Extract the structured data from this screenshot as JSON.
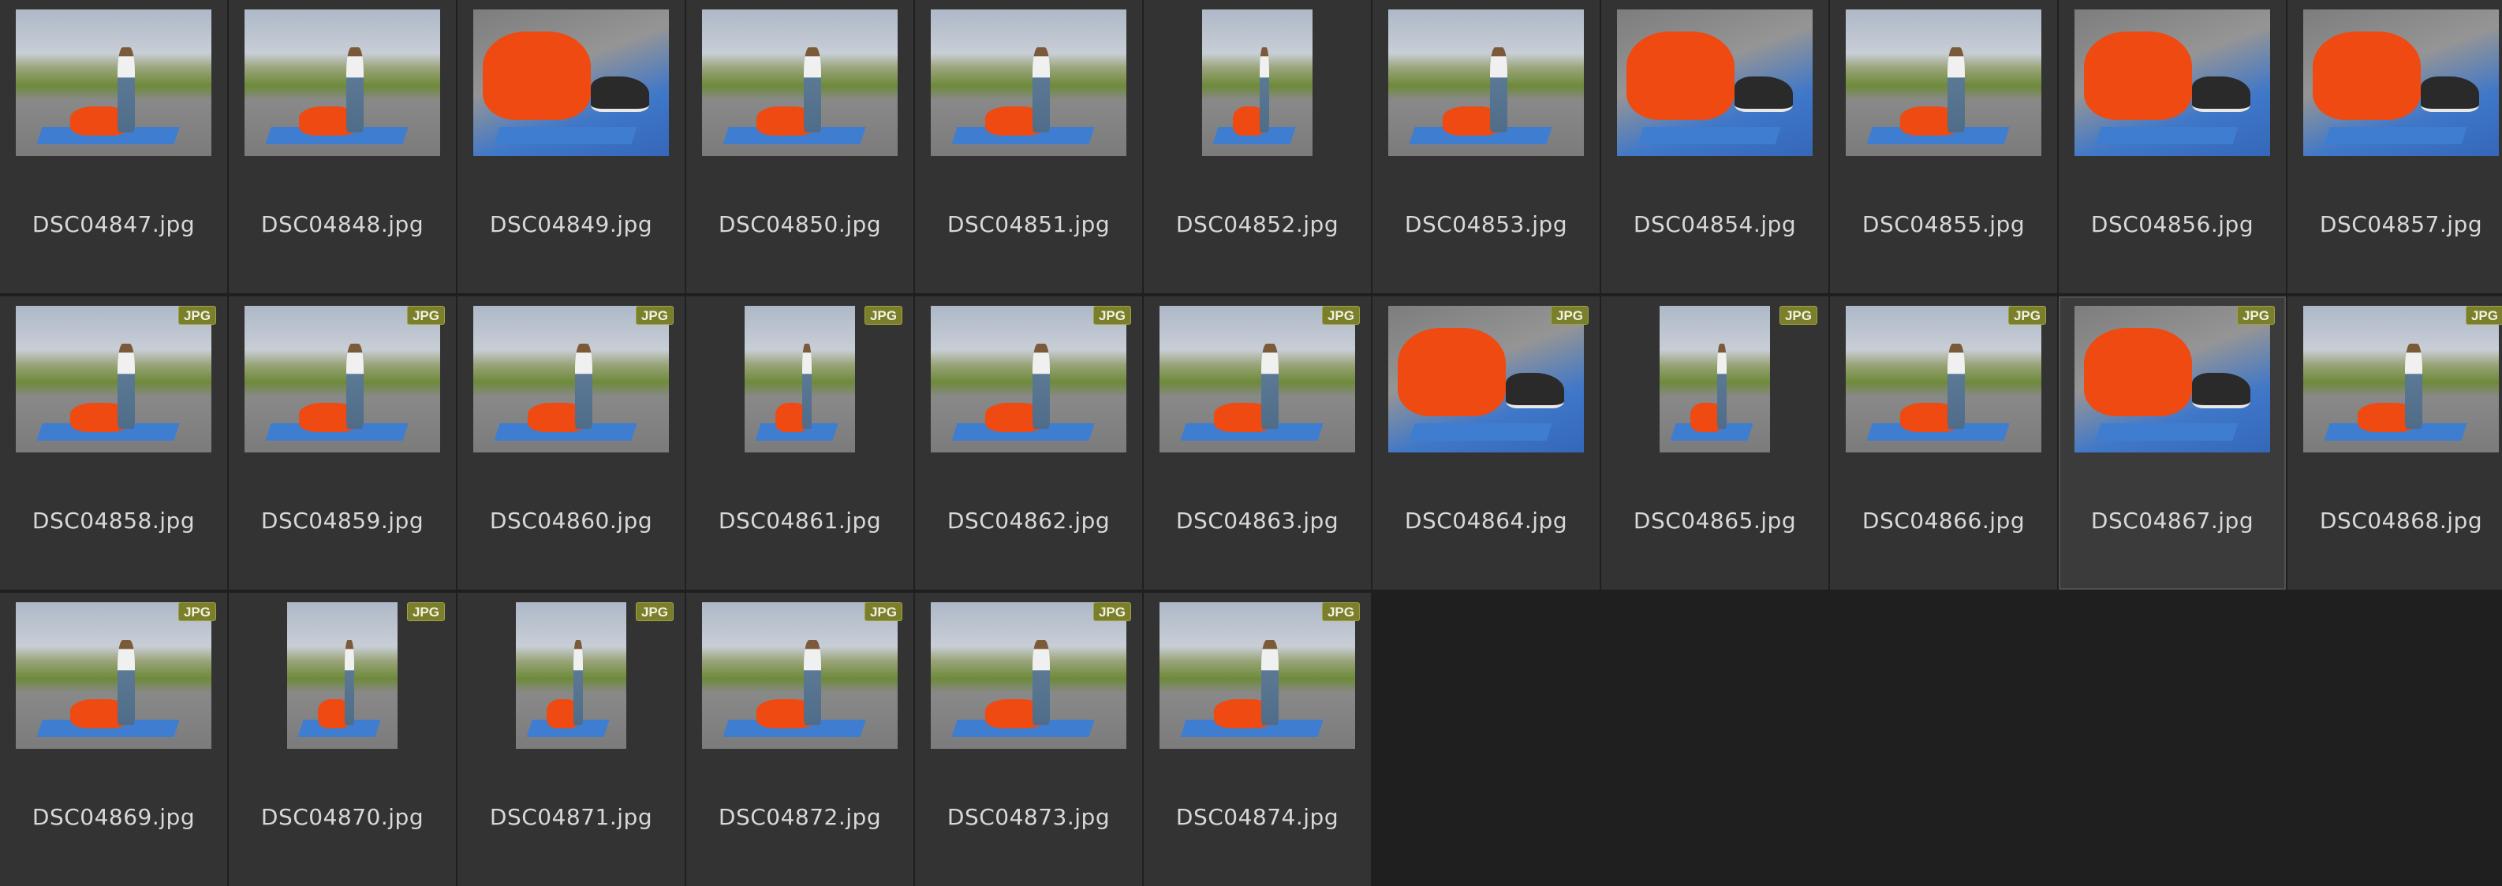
{
  "view": "large-icons",
  "badge_color": "#7b7f2c",
  "files": [
    {
      "name": "DSC04847.jpg",
      "badge": "",
      "orientation": "landscape",
      "thumb": "outdoor"
    },
    {
      "name": "DSC04848.jpg",
      "badge": "",
      "orientation": "landscape",
      "thumb": "outdoor"
    },
    {
      "name": "DSC04849.jpg",
      "badge": "",
      "orientation": "landscape",
      "thumb": "closeup"
    },
    {
      "name": "DSC04850.jpg",
      "badge": "",
      "orientation": "landscape",
      "thumb": "outdoor"
    },
    {
      "name": "DSC04851.jpg",
      "badge": "",
      "orientation": "landscape",
      "thumb": "outdoor"
    },
    {
      "name": "DSC04852.jpg",
      "badge": "",
      "orientation": "portrait",
      "thumb": "outdoor"
    },
    {
      "name": "DSC04853.jpg",
      "badge": "",
      "orientation": "landscape",
      "thumb": "outdoor"
    },
    {
      "name": "DSC04854.jpg",
      "badge": "",
      "orientation": "landscape",
      "thumb": "closeup"
    },
    {
      "name": "DSC04855.jpg",
      "badge": "",
      "orientation": "landscape",
      "thumb": "outdoor"
    },
    {
      "name": "DSC04856.jpg",
      "badge": "",
      "orientation": "landscape",
      "thumb": "closeup"
    },
    {
      "name": "DSC04857.jpg",
      "badge": "",
      "orientation": "landscape",
      "thumb": "closeup"
    },
    {
      "name": "DSC04858.jpg",
      "badge": "JPG",
      "orientation": "landscape",
      "thumb": "outdoor"
    },
    {
      "name": "DSC04859.jpg",
      "badge": "JPG",
      "orientation": "landscape",
      "thumb": "outdoor"
    },
    {
      "name": "DSC04860.jpg",
      "badge": "JPG",
      "orientation": "landscape",
      "thumb": "outdoor"
    },
    {
      "name": "DSC04861.jpg",
      "badge": "JPG",
      "orientation": "portrait",
      "thumb": "outdoor"
    },
    {
      "name": "DSC04862.jpg",
      "badge": "JPG",
      "orientation": "landscape",
      "thumb": "outdoor"
    },
    {
      "name": "DSC04863.jpg",
      "badge": "JPG",
      "orientation": "landscape",
      "thumb": "outdoor"
    },
    {
      "name": "DSC04864.jpg",
      "badge": "JPG",
      "orientation": "landscape",
      "thumb": "closeup"
    },
    {
      "name": "DSC04865.jpg",
      "badge": "JPG",
      "orientation": "portrait",
      "thumb": "outdoor"
    },
    {
      "name": "DSC04866.jpg",
      "badge": "JPG",
      "orientation": "landscape",
      "thumb": "outdoor"
    },
    {
      "name": "DSC04867.jpg",
      "badge": "JPG",
      "orientation": "landscape",
      "thumb": "closeup",
      "selected": true
    },
    {
      "name": "DSC04868.jpg",
      "badge": "JPG",
      "orientation": "landscape",
      "thumb": "outdoor"
    },
    {
      "name": "DSC04869.jpg",
      "badge": "JPG",
      "orientation": "landscape",
      "thumb": "outdoor"
    },
    {
      "name": "DSC04870.jpg",
      "badge": "JPG",
      "orientation": "portrait",
      "thumb": "outdoor"
    },
    {
      "name": "DSC04871.jpg",
      "badge": "JPG",
      "orientation": "portrait",
      "thumb": "outdoor"
    },
    {
      "name": "DSC04872.jpg",
      "badge": "JPG",
      "orientation": "landscape",
      "thumb": "outdoor"
    },
    {
      "name": "DSC04873.jpg",
      "badge": "JPG",
      "orientation": "landscape",
      "thumb": "outdoor"
    },
    {
      "name": "DSC04874.jpg",
      "badge": "JPG",
      "orientation": "landscape",
      "thumb": "outdoor"
    }
  ]
}
